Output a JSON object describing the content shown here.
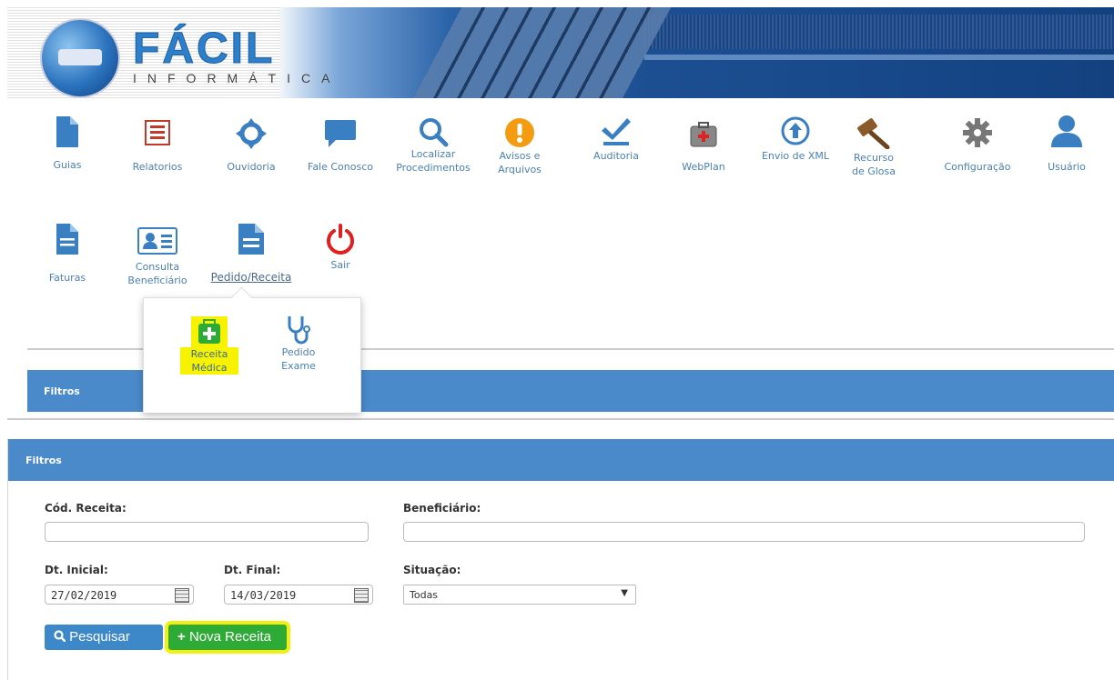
{
  "brand": {
    "logo_main": "FÁCIL",
    "logo_sub": "INFORMÁTICA"
  },
  "menu_row1": [
    {
      "label": "Guias",
      "icon": "document-icon"
    },
    {
      "label": "Relatorios",
      "icon": "list-icon"
    },
    {
      "label": "Ouvidoria",
      "icon": "crosshair-icon"
    },
    {
      "label": "Fale Conosco",
      "icon": "chat-icon"
    },
    {
      "label": "Localizar Procedimentos",
      "icon": "search-icon"
    },
    {
      "label": "Avisos e Arquivos",
      "icon": "alert-icon"
    },
    {
      "label": "Auditoria",
      "icon": "check-icon"
    },
    {
      "label": "WebPlan",
      "icon": "medkit-icon"
    },
    {
      "label": "Envio de XML",
      "icon": "upload-icon"
    },
    {
      "label": "Recurso de Glosa",
      "icon": "gavel-icon"
    },
    {
      "label": "Configuração",
      "icon": "gear-icon"
    },
    {
      "label": "Usuário",
      "icon": "user-icon"
    }
  ],
  "menu_row2": [
    {
      "label": "Faturas",
      "icon": "invoice-icon"
    },
    {
      "label": "Consulta Beneficiário",
      "icon": "id-card-icon"
    },
    {
      "label": "Pedido/Receita",
      "icon": "prescription-icon"
    },
    {
      "label": "Sair",
      "icon": "power-icon"
    }
  ],
  "dropdown": {
    "items": [
      {
        "label": "Receita Médica",
        "icon": "medical-case-icon"
      },
      {
        "label": "Pedido Exame",
        "icon": "stethoscope-icon"
      }
    ]
  },
  "panel_back": {
    "title": "Filtros"
  },
  "panel_front": {
    "title": "Filtros"
  },
  "form": {
    "cod_receita_label": "Cód. Receita:",
    "cod_receita_value": "",
    "beneficiario_label": "Beneficiário:",
    "beneficiario_value": "",
    "dt_inicial_label": "Dt. Inicial:",
    "dt_inicial_value": "27/02/2019",
    "dt_final_label": "Dt. Final:",
    "dt_final_value": "14/03/2019",
    "situacao_label": "Situação:",
    "situacao_value": "Todas"
  },
  "buttons": {
    "pesquisar": "Pesquisar",
    "nova_receita": "Nova Receita"
  },
  "colors": {
    "accent": "#4a8acb",
    "highlight": "#f7f200",
    "green": "#2eaa36",
    "icon_blue": "#3a7fc1",
    "icon_red": "#c0392b",
    "icon_orange": "#f39c12"
  }
}
